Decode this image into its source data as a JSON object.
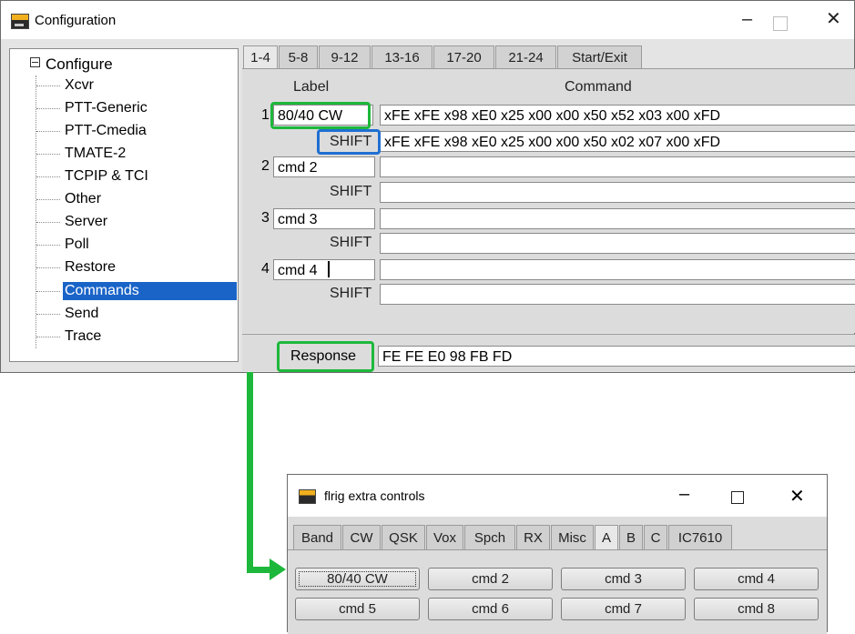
{
  "main_window": {
    "title": "Configuration",
    "controls": {
      "minimize": "–",
      "close": "✕"
    },
    "tree": {
      "root": "Configure",
      "items": [
        "Xcvr",
        "PTT-Generic",
        "PTT-Cmedia",
        "TMATE-2",
        "TCPIP & TCI",
        "Other",
        "Server",
        "Poll",
        "Restore",
        "Commands",
        "Send",
        "Trace"
      ],
      "selected": "Commands"
    },
    "tabs": [
      "1-4",
      "5-8",
      "9-12",
      "13-16",
      "17-20",
      "21-24",
      "Start/Exit"
    ],
    "active_tab": "1-4",
    "headers": {
      "label": "Label",
      "command": "Command"
    },
    "shift_label": "SHIFT",
    "rows": [
      {
        "num": "1",
        "label": "80/40 CW",
        "command": "xFE xFE x98 xE0 x25 x00 x00 x50 x52 x03 x00 xFD",
        "shift": "xFE xFE x98 xE0 x25 x00 x00 x50 x02 x07 x00 xFD"
      },
      {
        "num": "2",
        "label": "cmd 2",
        "command": "",
        "shift": ""
      },
      {
        "num": "3",
        "label": "cmd 3",
        "command": "",
        "shift": ""
      },
      {
        "num": "4",
        "label": "cmd 4",
        "command": "",
        "shift": ""
      }
    ],
    "response_label": "Response",
    "response_value": "FE FE E0 98 FB FD"
  },
  "extra_window": {
    "title": "flrig extra controls",
    "controls": {
      "minimize": "–",
      "close": "✕"
    },
    "tabs": [
      "Band",
      "CW",
      "QSK",
      "Vox",
      "Spch",
      "RX",
      "Misc",
      "A",
      "B",
      "C",
      "IC7610"
    ],
    "active_tab": "A",
    "buttons": [
      "80/40 CW",
      "cmd 2",
      "cmd 3",
      "cmd 4",
      "cmd 5",
      "cmd 6",
      "cmd 7",
      "cmd 8"
    ]
  },
  "colors": {
    "highlight_green": "#1db83b",
    "highlight_blue": "#1f6fd1",
    "selection": "#1a64c8"
  }
}
